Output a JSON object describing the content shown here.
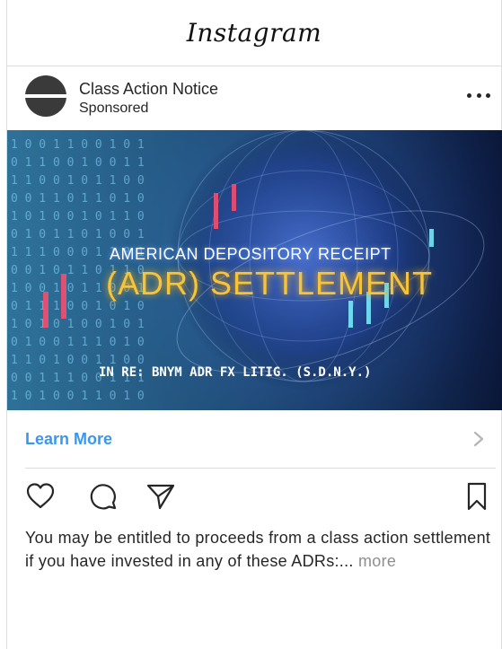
{
  "app": {
    "title": "Instagram"
  },
  "post": {
    "account_name": "Class Action Notice",
    "sponsored_label": "Sponsored",
    "more_icon": "ellipsis-icon",
    "ad_image": {
      "line1": "AMERICAN DEPOSITORY RECEIPT",
      "line2": "(ADR) SETTLEMENT",
      "line3": "IN RE: BNYM ADR FX LITIG. (S.D.N.Y.)"
    },
    "cta": {
      "label": "Learn More",
      "icon": "chevron-right-icon"
    },
    "actions": [
      "heart-icon",
      "comment-icon",
      "share-icon",
      "bookmark-icon"
    ],
    "caption": {
      "text": "You may be entitled to proceeds from a class action settlement if you have invested in any of these ADRs:...",
      "more": "more"
    }
  },
  "colors": {
    "link_blue": "#3897f0",
    "headline_gold": "#f5c33c",
    "text": "#262626",
    "muted": "#8e8e8e"
  }
}
